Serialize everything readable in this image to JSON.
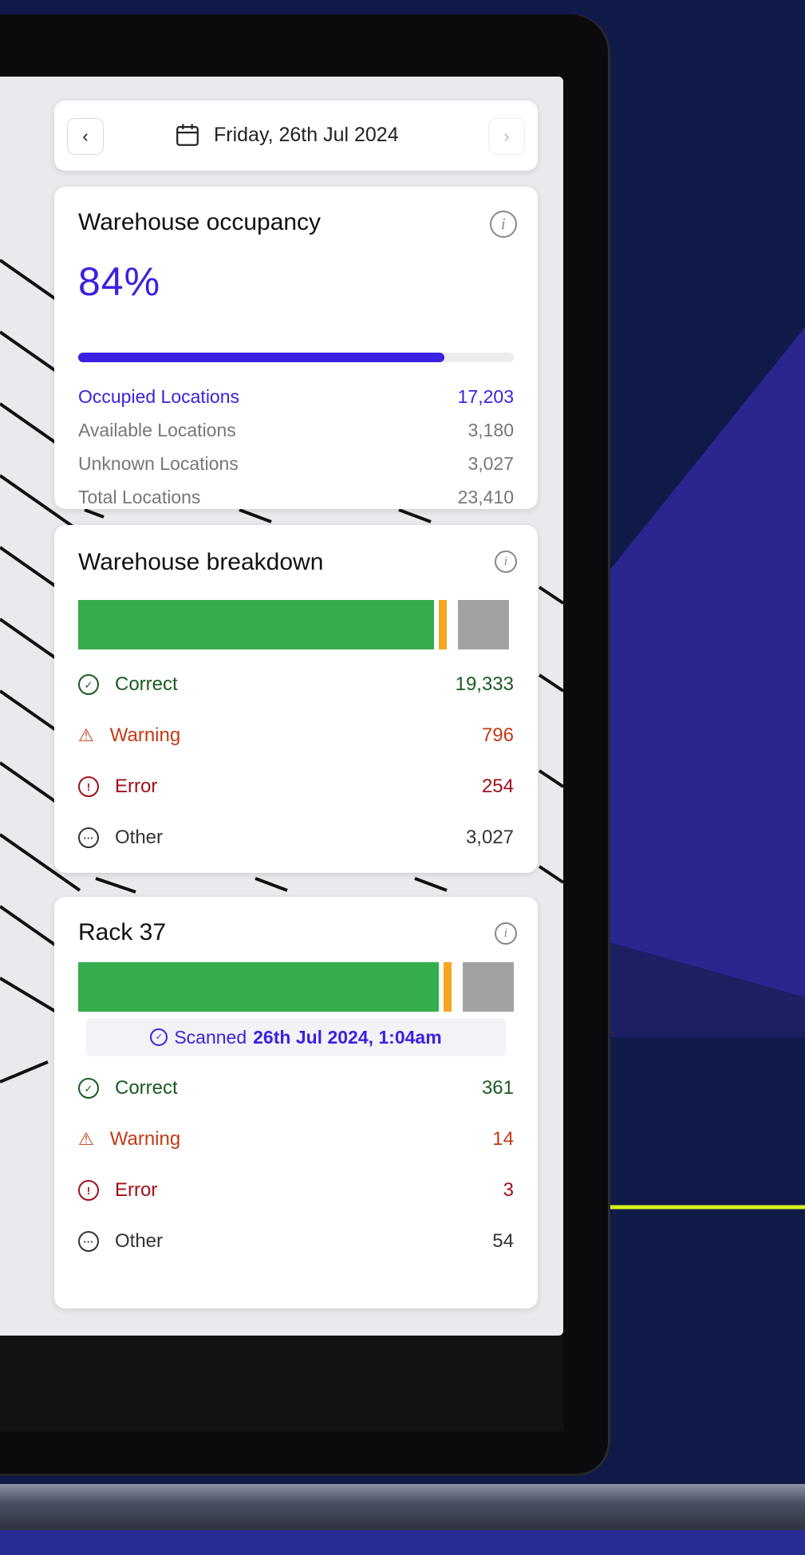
{
  "date_bar": {
    "prev_label": "‹",
    "next_label": "›",
    "date": "Friday, 26th Jul 2024"
  },
  "occupancy": {
    "title": "Warehouse occupancy",
    "percent_label": "84%",
    "percent": 0.84,
    "rows": [
      {
        "label": "Occupied Locations",
        "value": "17,203"
      },
      {
        "label": "Available Locations",
        "value": "3,180"
      },
      {
        "label": "Unknown Locations",
        "value": "3,027"
      },
      {
        "label": "Total Locations",
        "value": "23,410"
      }
    ]
  },
  "breakdown": {
    "title": "Warehouse breakdown",
    "rows": [
      {
        "label": "Correct",
        "value": "19,333"
      },
      {
        "label": "Warning",
        "value": "796"
      },
      {
        "label": "Error",
        "value": "254"
      },
      {
        "label": "Other",
        "value": "3,027"
      }
    ]
  },
  "rack": {
    "title": "Rack 37",
    "scanned_prefix": "Scanned",
    "scanned_date": "26th Jul 2024, 1:04am",
    "rows": [
      {
        "label": "Correct",
        "value": "361"
      },
      {
        "label": "Warning",
        "value": "14"
      },
      {
        "label": "Error",
        "value": "3"
      },
      {
        "label": "Other",
        "value": "54"
      }
    ]
  },
  "colors": {
    "accent": "#3b21e0",
    "correct": "#35ad4c",
    "warning": "#f6a521",
    "other": "#a2a2a4",
    "accent_line": "#d4f21a"
  },
  "icons": {
    "calendar": "calendar-icon",
    "info": "info-icon",
    "correct": "check-circle-icon",
    "warning": "warning-triangle-icon",
    "error": "exclamation-circle-icon",
    "other": "ellipsis-circle-icon"
  }
}
